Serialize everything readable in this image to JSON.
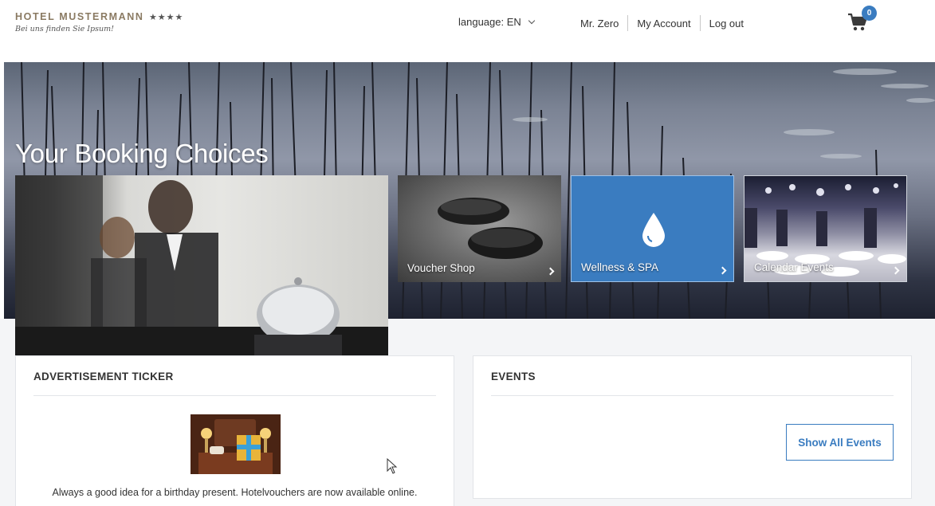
{
  "header": {
    "hotel_name": "HOTEL MUSTERMANN",
    "stars": "★★★★",
    "tagline": "Bei uns finden Sie Ipsum!",
    "language_label": "language: EN",
    "user_name": "Mr. Zero",
    "my_account": "My Account",
    "logout": "Log out",
    "cart_count": "0",
    "cart_icon": "shopping-cart-icon"
  },
  "hero": {
    "title": "Your Booking Choices"
  },
  "tiles": {
    "voucher_shop": "Voucher Shop",
    "wellness_spa": "Wellness & SPA",
    "calendar_events": "Calendar Events",
    "wellness_icon": "water-drop-icon"
  },
  "ad_panel": {
    "title": "ADVERTISEMENT TICKER",
    "text": "Always a good idea for a birthday present. Hotelvouchers are now available online."
  },
  "events_panel": {
    "title": "EVENTS",
    "button": "Show All Events"
  },
  "colors": {
    "accent": "#3a7cc0",
    "logo_text": "#8a7a62"
  }
}
